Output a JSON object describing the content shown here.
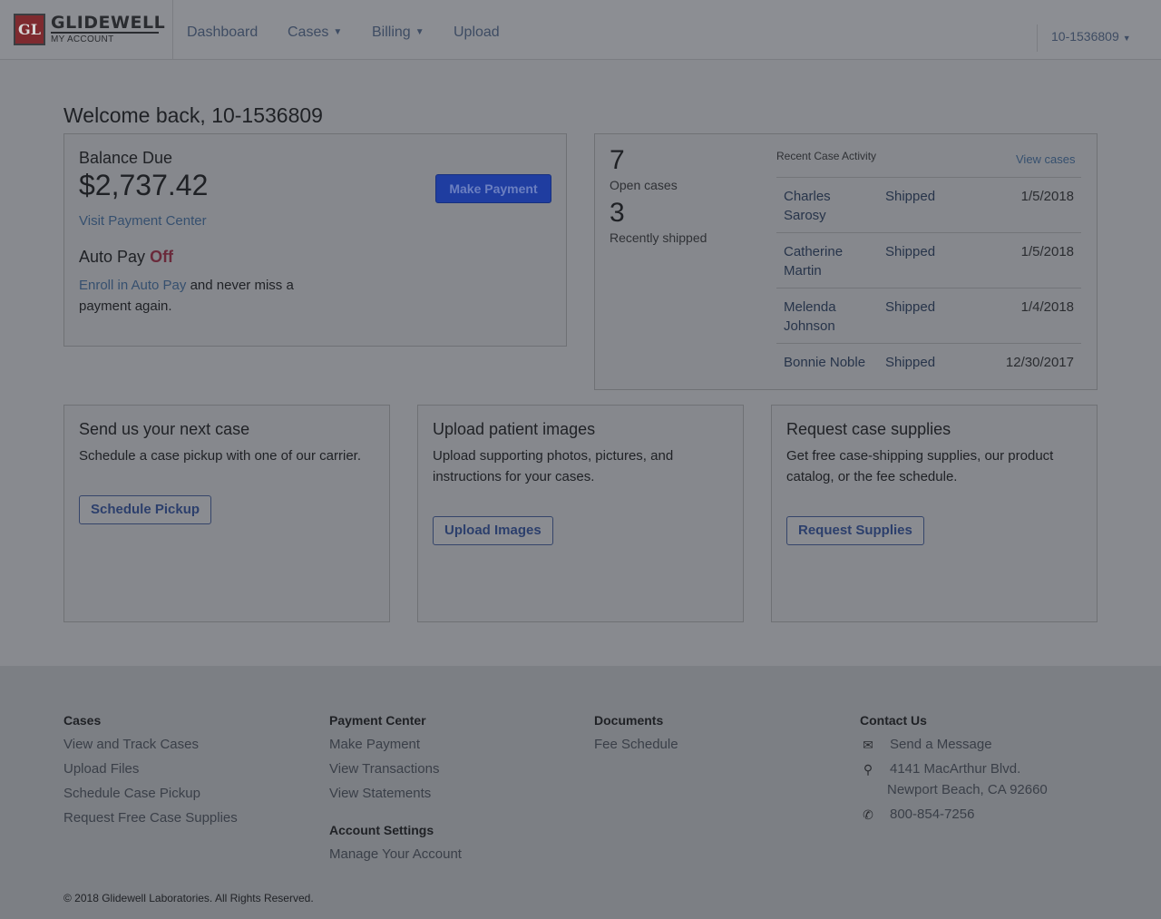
{
  "brand": {
    "mark": "GL",
    "name": "GLIDEWELL",
    "sub": "MY ACCOUNT"
  },
  "nav": {
    "dashboard": "Dashboard",
    "cases": "Cases",
    "billing": "Billing",
    "upload": "Upload",
    "account": "10-1536809"
  },
  "welcome": "Welcome back, 10-1536809",
  "balance": {
    "label": "Balance Due",
    "amount": "$2,737.42",
    "pay_button": "Make Payment",
    "visit_link": "Visit Payment Center",
    "autopay_label": "Auto Pay",
    "autopay_state": "Off",
    "enroll_link": "Enroll in Auto Pay",
    "enroll_text": " and never miss a payment again."
  },
  "stats": {
    "open_count": "7",
    "open_label": "Open cases",
    "shipped_count": "3",
    "shipped_label": "Recently shipped"
  },
  "activity": {
    "title": "Recent Case Activity",
    "view_link": "View cases",
    "rows": [
      {
        "name": "Charles Sarosy",
        "status": "Shipped",
        "date": "1/5/2018"
      },
      {
        "name": "Catherine Martin",
        "status": "Shipped",
        "date": "1/5/2018"
      },
      {
        "name": "Melenda Johnson",
        "status": "Shipped",
        "date": "1/4/2018"
      },
      {
        "name": "Bonnie Noble",
        "status": "Shipped",
        "date": "12/30/2017"
      }
    ]
  },
  "cards": [
    {
      "title": "Send us your next case",
      "desc": "Schedule a case pickup with one of our carrier.",
      "button": "Schedule Pickup"
    },
    {
      "title": "Upload patient images",
      "desc": "Upload supporting photos, pictures, and instructions for your cases.",
      "button": "Upload Images"
    },
    {
      "title": "Request case supplies",
      "desc": "Get free case-shipping supplies, our product catalog, or the fee schedule.",
      "button": "Request Supplies"
    }
  ],
  "footer": {
    "cases": {
      "heading": "Cases",
      "links": [
        "View and Track Cases",
        "Upload Files",
        "Schedule Case Pickup",
        "Request Free Case Supplies"
      ]
    },
    "payment": {
      "heading": "Payment Center",
      "links": [
        "Make Payment",
        "View Transactions",
        "View Statements"
      ]
    },
    "account_settings": {
      "heading": "Account Settings",
      "links": [
        "Manage Your Account"
      ]
    },
    "documents": {
      "heading": "Documents",
      "links": [
        "Fee Schedule"
      ]
    },
    "contact": {
      "heading": "Contact Us",
      "message": "Send a Message",
      "address1": "4141 MacArthur Blvd.",
      "address2": "Newport Beach, CA 92660",
      "phone": "800-854-7256"
    },
    "copyright": "© 2018 Glidewell Laboratories. All Rights Reserved."
  },
  "icons": {
    "message": "envelope-icon",
    "address": "map-marker-icon",
    "phone": "phone-icon",
    "dropdown": "caret-down-icon"
  },
  "colors": {
    "primary_button": "#1f3da0",
    "autopay_off": "#6a2a3b",
    "link": "#36506f"
  }
}
